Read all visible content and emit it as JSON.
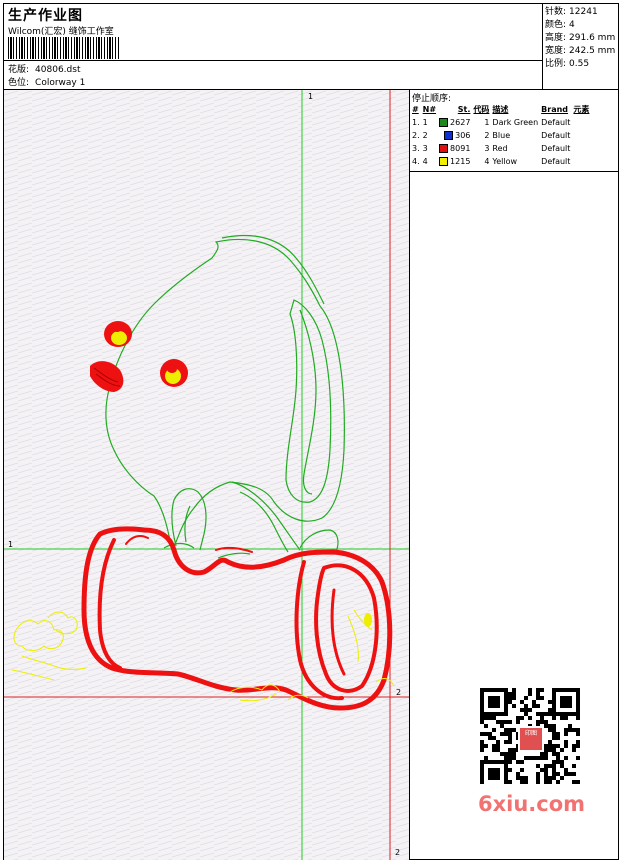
{
  "header": {
    "title": "生产作业图",
    "company": "Wilcom(汇宏) 缝饰工作室",
    "design_label": "花版:",
    "design_file": "40806.dst",
    "colorway_label": "色位:",
    "colorway": "Colorway 1"
  },
  "stats": [
    {
      "label": "针数:",
      "value": "12241"
    },
    {
      "label": "颜色:",
      "value": "4"
    },
    {
      "label": "高度:",
      "value": "291.6 mm"
    },
    {
      "label": "宽度:",
      "value": "242.5 mm"
    },
    {
      "label": "比例:",
      "value": "0.55"
    }
  ],
  "sequence": {
    "title": "停止顺序:",
    "columns": [
      "#",
      "N#",
      "St.",
      "代码",
      "描述",
      "Brand",
      "元素"
    ],
    "rows": [
      {
        "num": "1.",
        "n": "1",
        "color": "#1a8a1a",
        "st": "2627",
        "code": "1",
        "desc": "Dark Green",
        "brand": "Default",
        "elem": ""
      },
      {
        "num": "2.",
        "n": "2",
        "color": "#1030d0",
        "st": "306",
        "code": "2",
        "desc": "Blue",
        "brand": "Default",
        "elem": ""
      },
      {
        "num": "3.",
        "n": "3",
        "color": "#e01010",
        "st": "8091",
        "code": "3",
        "desc": "Red",
        "brand": "Default",
        "elem": ""
      },
      {
        "num": "4.",
        "n": "4",
        "color": "#f0f000",
        "st": "1215",
        "code": "4",
        "desc": "Yellow",
        "brand": "Default",
        "elem": ""
      }
    ]
  },
  "axes": {
    "v_green_top": "1",
    "h_green_left": "1",
    "v_red_bottom": "2",
    "h_red_right": "2"
  },
  "colors": {
    "outline_green": "#22aa22",
    "fill_red": "#ee1111",
    "yellow": "#eeee00",
    "guide_green": "#22cc22",
    "guide_red": "#dd2222"
  },
  "watermark": {
    "text": "6xiu.com",
    "seal_text": "印图"
  }
}
